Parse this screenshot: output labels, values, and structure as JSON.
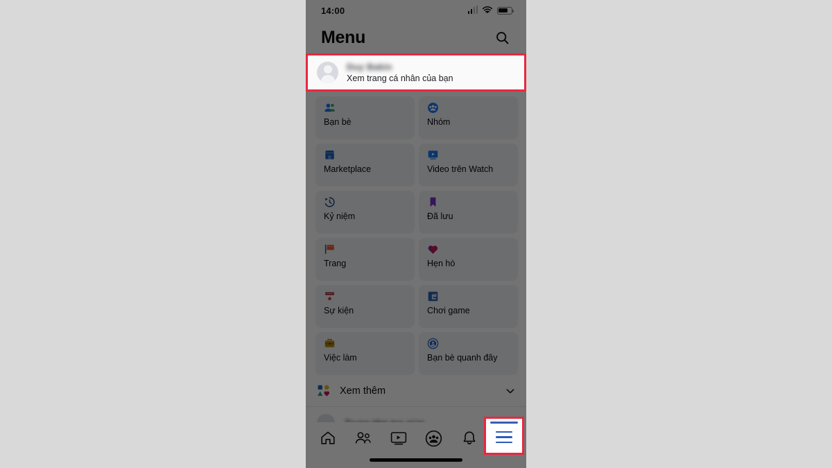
{
  "app": {
    "platform": "ios",
    "screen_bg": "#ffffff",
    "page_bg": "#d9d9d9"
  },
  "status_bar": {
    "time": "14:00",
    "signal_icon": "cellular-signal-icon",
    "wifi_icon": "wifi-icon",
    "battery_icon": "battery-icon"
  },
  "header": {
    "title": "Menu",
    "search_icon": "search-icon"
  },
  "profile": {
    "name": "Duy Bakin",
    "subtitle": "Xem trang cá nhân của bạn",
    "avatar_icon": "avatar-placeholder-icon",
    "redacted": true
  },
  "menu_grid": {
    "items": [
      {
        "label": "Bạn bè",
        "icon": "friends-icon",
        "color": "#1877f2"
      },
      {
        "label": "Nhóm",
        "icon": "groups-icon",
        "color": "#1877f2"
      },
      {
        "label": "Marketplace",
        "icon": "marketplace-icon",
        "color": "#1f5fbf"
      },
      {
        "label": "Video trên Watch",
        "icon": "watch-video-icon",
        "color": "#1877f2"
      },
      {
        "label": "Kỷ niệm",
        "icon": "memories-clock-icon",
        "color": "#1d3f73"
      },
      {
        "label": "Đã lưu",
        "icon": "saved-bookmark-icon",
        "color": "#7b2fbe"
      },
      {
        "label": "Trang",
        "icon": "pages-flag-icon",
        "color": "#e8552d"
      },
      {
        "label": "Hẹn hò",
        "icon": "dating-heart-icon",
        "color": "#c2185b"
      },
      {
        "label": "Sự kiện",
        "icon": "events-ticket-icon",
        "color": "#b02a37"
      },
      {
        "label": "Chơi game",
        "icon": "gaming-icon",
        "color": "#2a63b0"
      },
      {
        "label": "Việc làm",
        "icon": "jobs-briefcase-icon",
        "color": "#9a6b14"
      },
      {
        "label": "Bạn bè quanh đây",
        "icon": "nearby-friends-icon",
        "color": "#1f5fbf"
      }
    ]
  },
  "see_more": {
    "label": "Xem thêm",
    "icon": "shapes-grid-icon",
    "chevron_icon": "chevron-down-icon"
  },
  "partial_row": {
    "label": "Trung tâm trợ giúp",
    "icon": "help-circle-icon",
    "redacted": true
  },
  "tab_bar": {
    "tabs": [
      {
        "name": "home",
        "icon": "home-icon",
        "active": false
      },
      {
        "name": "friends",
        "icon": "friends-tab-icon",
        "active": false
      },
      {
        "name": "watch",
        "icon": "watch-tab-icon",
        "active": false
      },
      {
        "name": "groups",
        "icon": "groups-tab-icon",
        "active": false
      },
      {
        "name": "notifications",
        "icon": "bell-icon",
        "active": false
      },
      {
        "name": "menu",
        "icon": "hamburger-menu-icon",
        "active": true
      }
    ],
    "active_color": "#2e5bb8",
    "home_indicator": true
  },
  "annotations": {
    "highlight_color": "#e8283f",
    "boxes": [
      {
        "target": "profile-row",
        "label": "Xem trang cá nhân của bạn"
      },
      {
        "target": "menu-tab-button",
        "label": "hamburger-menu-icon"
      }
    ]
  },
  "overlay": {
    "dim_color": "rgba(0,0,0,0.55)"
  }
}
